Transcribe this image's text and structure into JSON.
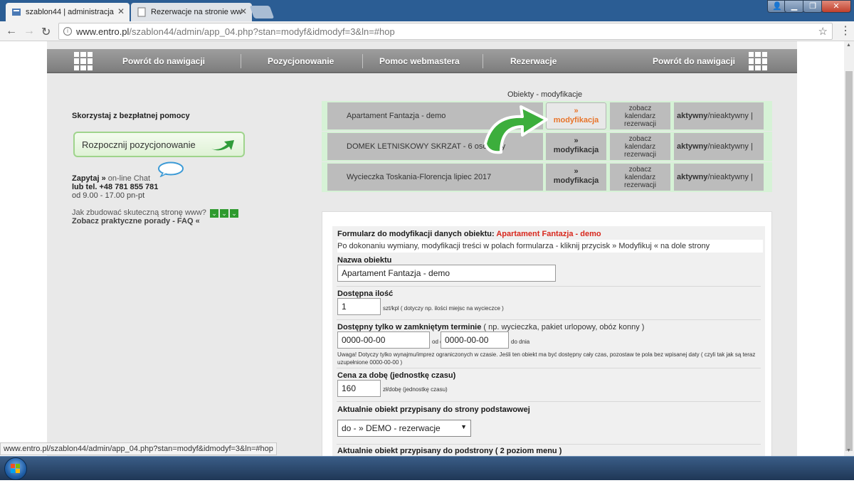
{
  "browser": {
    "tabs": [
      {
        "title": "szablon44 | administracja"
      },
      {
        "title": "Rezerwacje na stronie ww"
      }
    ],
    "url_host": "www.entro.pl",
    "url_path": "/szablon44/admin/app_04.php?stan=modyf&idmodyf=3&ln=#hop",
    "status_url": "www.entro.pl/szablon44/admin/app_04.php?stan=modyf&idmodyf=3&ln=#hop"
  },
  "nav": {
    "items": [
      "Powrót do nawigacji",
      "Pozycjonowanie",
      "Pomoc webmastera",
      "Rezerwacje",
      "Powrót do nawigacji"
    ]
  },
  "sidebar": {
    "help_title": "Skorzystaj z bezpłatnej pomocy",
    "positioning_button": "Rozpocznij pozycjonowanie",
    "ask": "Zapytaj »",
    "chat": " on-line Chat",
    "phone": "lub tel. +48 781 855 781",
    "hours": "od 9.00 - 17.00 pn-pt",
    "how_to": "Jak zbudować skuteczną stronę www?",
    "faq": "Zobacz praktyczne porady - FAQ «"
  },
  "objects": {
    "title": "Obiekty - modyfikacje",
    "rows": [
      {
        "name": "Apartament Fantazja - demo",
        "mod_arrow": "»",
        "mod": "modyfikacja",
        "cal1": "zobacz",
        "cal2": "kalendarz",
        "cal3": "rezerwacji",
        "active": "aktywny",
        "inactive": "/nieaktywny |"
      },
      {
        "name": "DOMEK LETNISKOWY SKRZAT - 6 osobowy",
        "mod_arrow": "»",
        "mod": "modyfikacja",
        "cal1": "zobacz",
        "cal2": "kalendarz",
        "cal3": "rezerwacji",
        "active": "aktywny",
        "inactive": "/nieaktywny |"
      },
      {
        "name": "Wycieczka Toskania-Florencja lipiec 2017",
        "mod_arrow": "»",
        "mod": "modyfikacja",
        "cal1": "zobacz",
        "cal2": "kalendarz",
        "cal3": "rezerwacji",
        "active": "aktywny",
        "inactive": "/nieaktywny |"
      }
    ]
  },
  "form": {
    "title": "Formularz do modyfikacji danych obiektu:",
    "object": "Apartament Fantazja - demo",
    "hint": "Po dokonaniu wymiany, modyfikacji treści w polach formularza - kliknij przycisk » Modyfikuj « na dole strony",
    "name_label": "Nazwa obiektu",
    "name_value": "Apartament Fantazja - demo",
    "qty_label": "Dostępna ilość",
    "qty_value": "1",
    "qty_note": "szt/kpl ( dotyczy np. ilości miejsc na wycieczce )",
    "term_label": "Dostępny tylko w zamkniętym terminie",
    "term_note": " ( np. wycieczka, pakiet urlopowy, obóz konny )",
    "date_from": "0000-00-00",
    "from_label": "od dnia |",
    "date_to": "0000-00-00",
    "to_label": "do dnia",
    "warning": "Uwaga! Dotyczy tylko wynajmu/imprez ograniczonych w czasie. Jeśli ten obiekt ma być dostępny cały czas, pozostaw te pola bez wpisanej daty ( czyli tak jak są teraz uzupełnione 0000-00-00 )",
    "price_label": "Cena za dobę (jednostkę czasu)",
    "price_value": "160",
    "price_note": "zł/dobę (jednostkę czasu)",
    "page_label": "Aktualnie obiekt przypisany do strony podstawowej",
    "page_select": "do - » DEMO - rezerwacje",
    "subpage_label": "Aktualnie obiekt przypisany do podstrony ( 2 poziom menu )"
  }
}
